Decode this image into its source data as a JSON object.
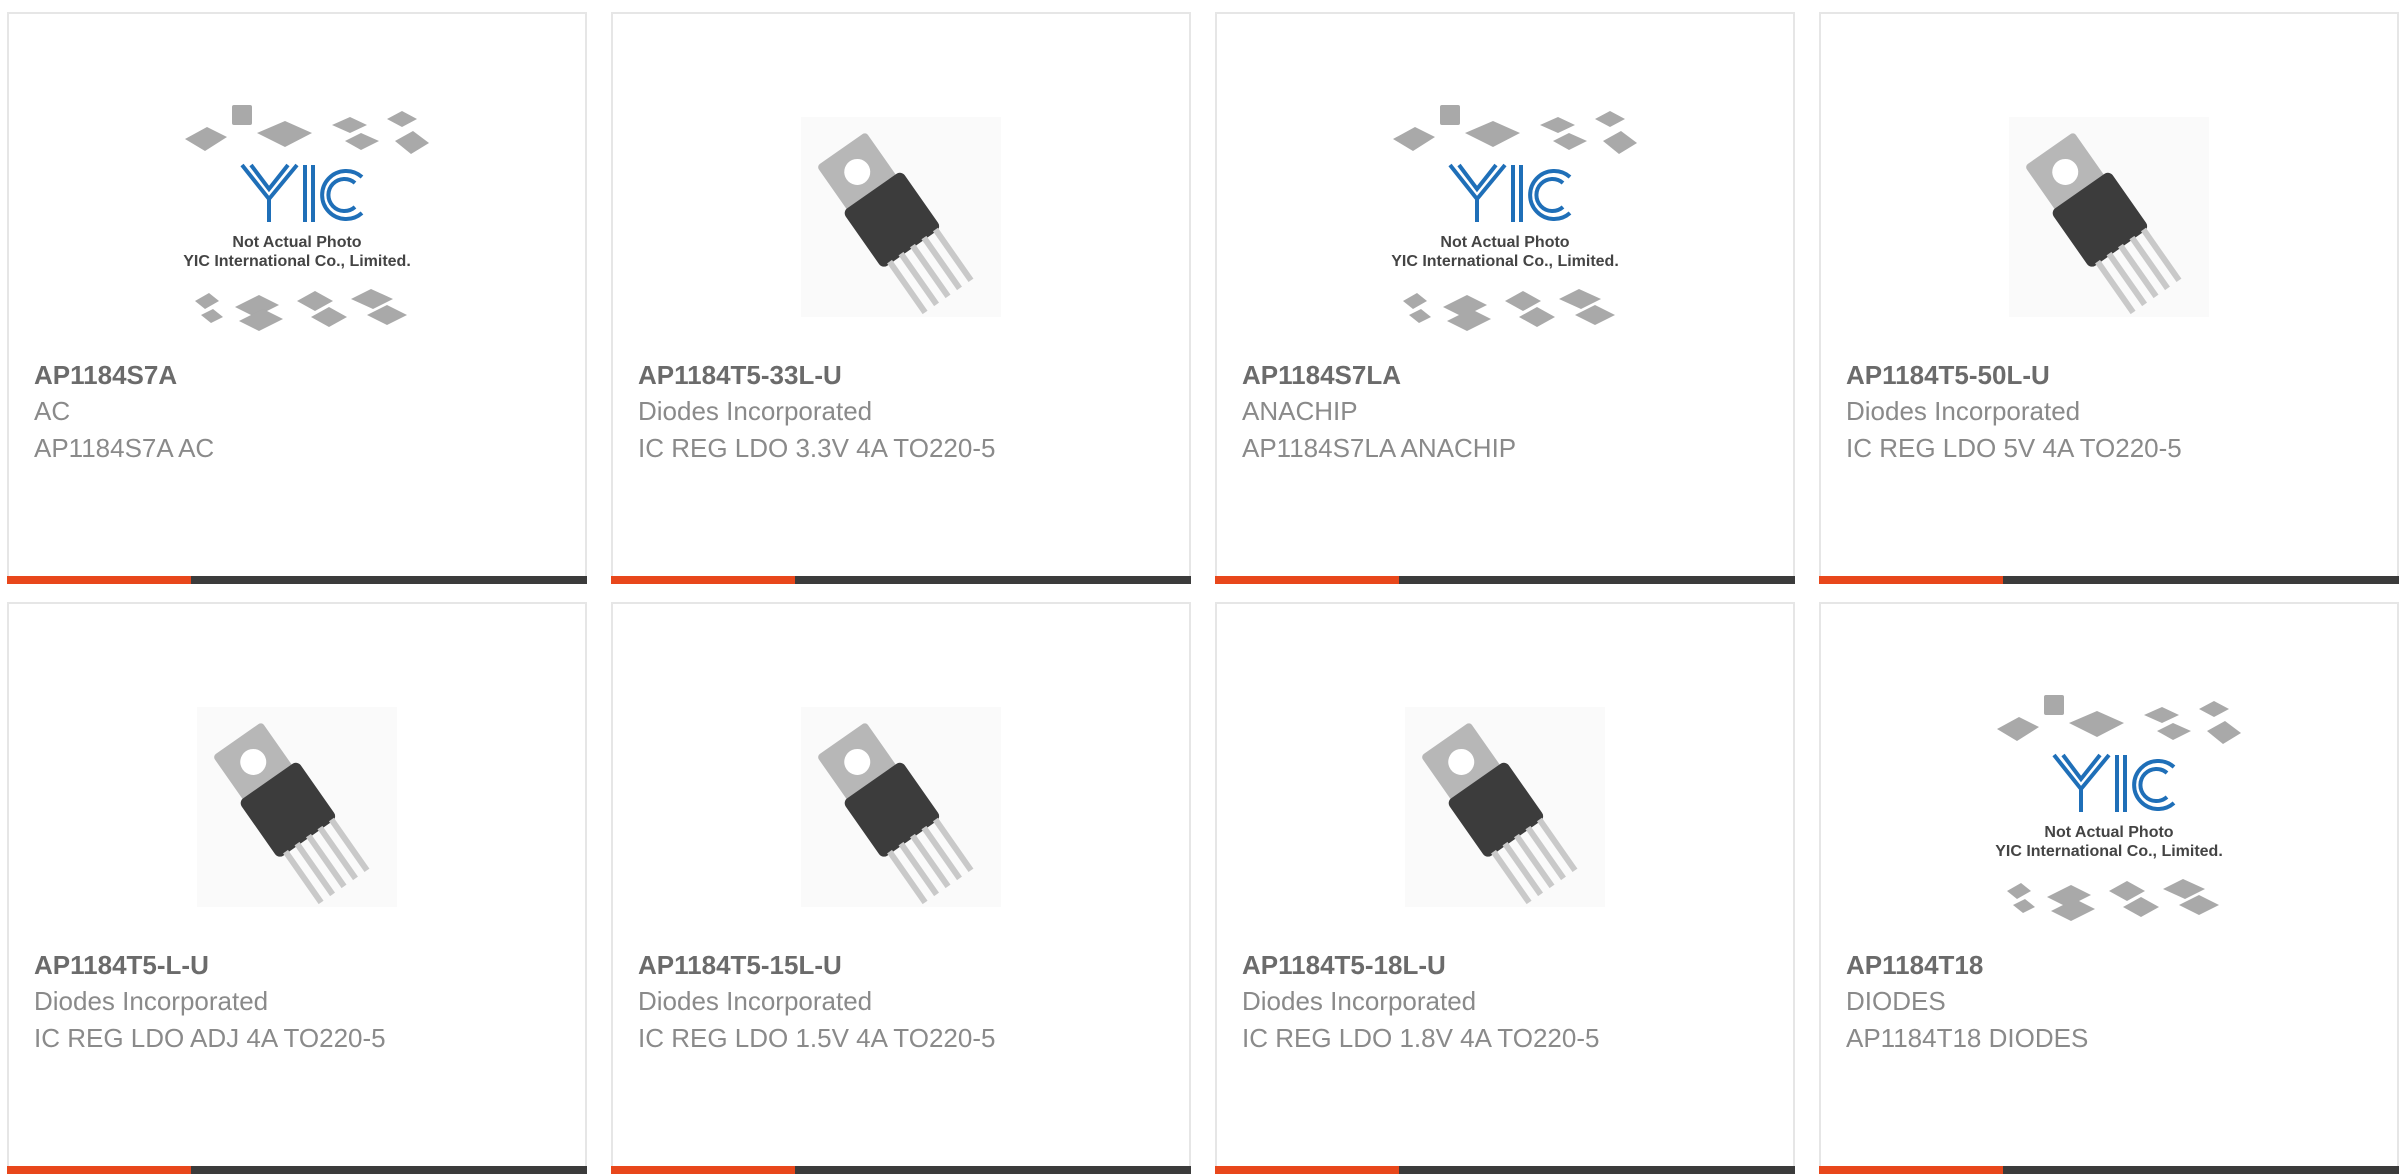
{
  "cards": [
    {
      "part": "AP1184S7A",
      "manufacturer": "AC",
      "description": "AP1184S7A AC",
      "image": "placeholder-photo-icon"
    },
    {
      "part": "AP1184T5-33L-U",
      "manufacturer": "Diodes Incorporated",
      "description": "IC REG LDO 3.3V 4A TO220-5",
      "image": "to220-package-icon"
    },
    {
      "part": "AP1184S7LA",
      "manufacturer": "ANACHIP",
      "description": "AP1184S7LA ANACHIP",
      "image": "placeholder-photo-icon"
    },
    {
      "part": "AP1184T5-50L-U",
      "manufacturer": "Diodes Incorporated",
      "description": "IC REG LDO 5V 4A TO220-5",
      "image": "to220-package-icon"
    },
    {
      "part": "AP1184T5-L-U",
      "manufacturer": "Diodes Incorporated",
      "description": "IC REG LDO ADJ 4A TO220-5",
      "image": "to220-package-icon"
    },
    {
      "part": "AP1184T5-15L-U",
      "manufacturer": "Diodes Incorporated",
      "description": "IC REG LDO 1.5V 4A TO220-5",
      "image": "to220-package-icon"
    },
    {
      "part": "AP1184T5-18L-U",
      "manufacturer": "Diodes Incorporated",
      "description": "IC REG LDO 1.8V 4A TO220-5",
      "image": "to220-package-icon"
    },
    {
      "part": "AP1184T18",
      "manufacturer": "DIODES",
      "description": "AP1184T18 DIODES",
      "image": "placeholder-photo-icon"
    }
  ],
  "placeholder": {
    "logo_text": "YIC",
    "line1": "Not Actual Photo",
    "line2": "YIC International Co., Limited."
  },
  "colors": {
    "accent": "#e8471b",
    "bar": "#3b3b3b",
    "part_text": "#6b6b6b",
    "sub_text": "#8a8a8a",
    "logo_blue": "#1f6fb8"
  }
}
